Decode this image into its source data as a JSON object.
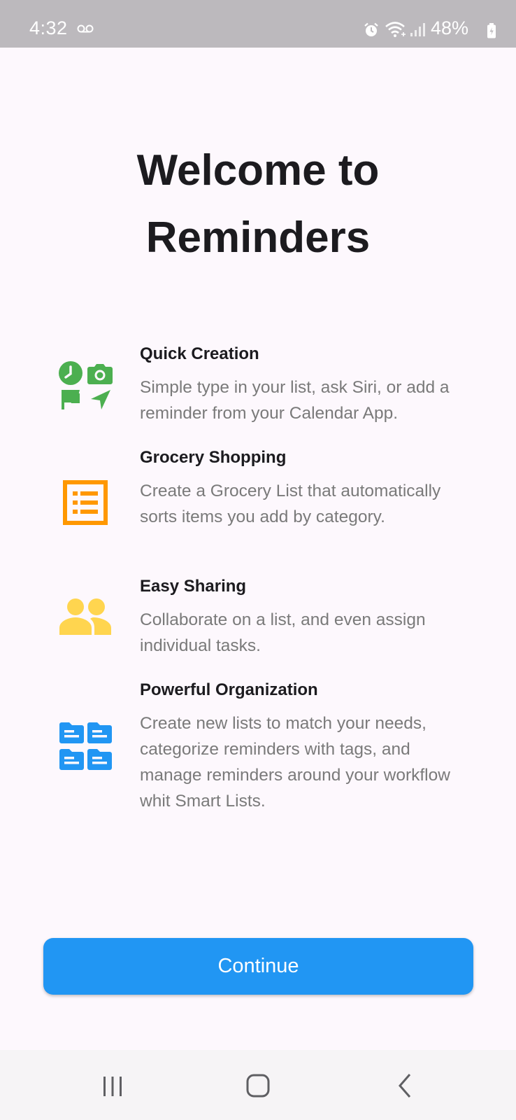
{
  "status_bar": {
    "time": "4:32",
    "battery": "48%",
    "icons": [
      "voicemail-icon",
      "alarm-icon",
      "wifi-icon",
      "signal-icon",
      "battery-icon"
    ]
  },
  "welcome": {
    "title_line1": "Welcome to",
    "title_line2": "Reminders"
  },
  "features": [
    {
      "title": "Quick Creation",
      "description": "Simple type in your list, ask Siri, or add a reminder from your Calendar App.",
      "icon": "quick-creation-icon",
      "color": "#4caf50"
    },
    {
      "title": "Grocery Shopping",
      "description": "Create a Grocery List that automatically sorts items you add by category.",
      "icon": "list-icon",
      "color": "#ff9800"
    },
    {
      "title": "Easy Sharing",
      "description": "Collaborate on a list, and even assign individual tasks.",
      "icon": "people-icon",
      "color": "#ffd54f"
    },
    {
      "title": "Powerful Organization",
      "description": "Create new lists to match your needs, categorize reminders with tags, and manage reminders around your workflow whit Smart Lists.",
      "icon": "folders-icon",
      "color": "#2196f3"
    }
  ],
  "continue_button": {
    "label": "Continue",
    "color": "#2196f3"
  },
  "nav_bar": {
    "icons": [
      "recent-apps-icon",
      "home-icon",
      "back-icon"
    ]
  }
}
